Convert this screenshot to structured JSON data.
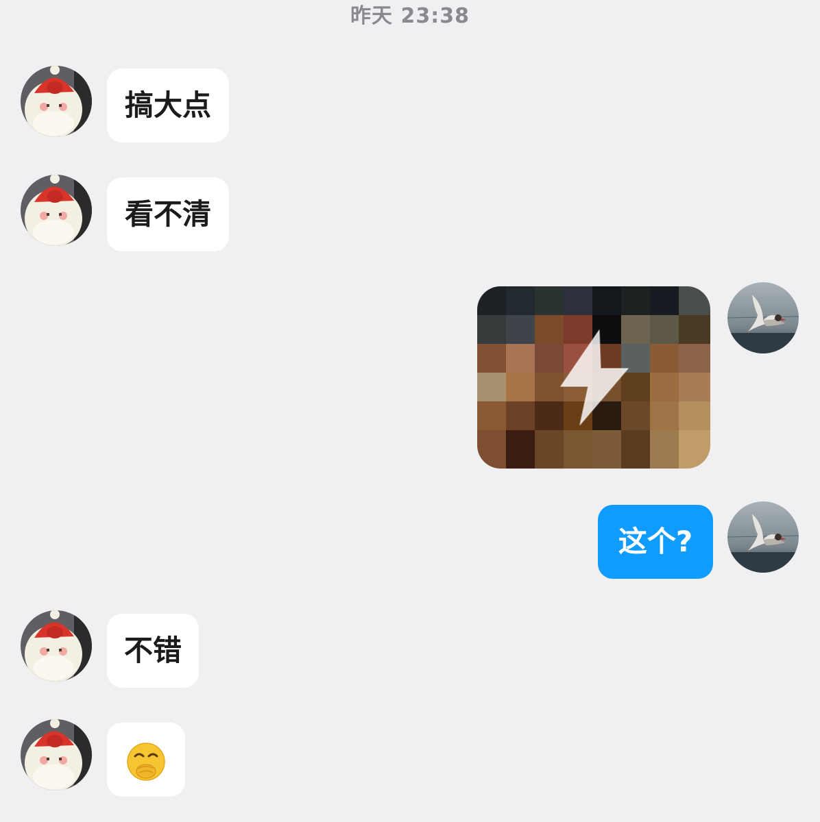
{
  "timestamp": "昨天 23:38",
  "messages": [
    {
      "id": "m1",
      "direction": "incoming",
      "type": "text",
      "text": "搞大点"
    },
    {
      "id": "m2",
      "direction": "incoming",
      "type": "text",
      "text": "看不清"
    },
    {
      "id": "m3",
      "direction": "outgoing",
      "type": "image",
      "image": "pixelated-flash-photo",
      "overlay_icon": "lightning-bolt-icon"
    },
    {
      "id": "m4",
      "direction": "outgoing",
      "type": "text",
      "text": "这个?"
    },
    {
      "id": "m5",
      "direction": "incoming",
      "type": "text",
      "text": "不错"
    },
    {
      "id": "m6",
      "direction": "incoming",
      "type": "emoji",
      "emoji": "face-with-hand-over-mouth-icon"
    }
  ],
  "avatars": {
    "contact": "santa-cake-avatar",
    "self": "seagull-avatar"
  },
  "colors": {
    "background": "#f0f0f3",
    "incoming_bubble": "#ffffff",
    "outgoing_bubble": "#109bff",
    "timestamp_text": "#8a8a8e"
  }
}
